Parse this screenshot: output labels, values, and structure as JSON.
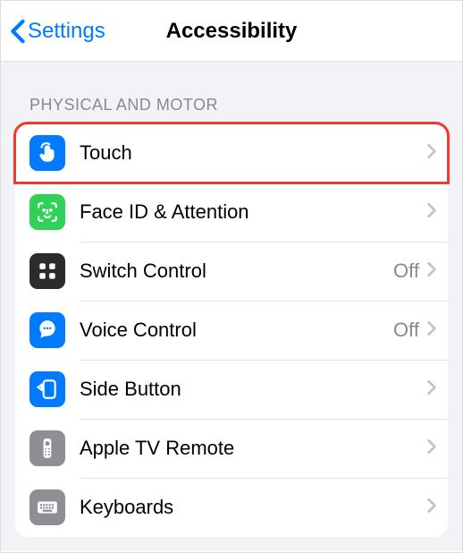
{
  "nav": {
    "back_label": "Settings",
    "title": "Accessibility"
  },
  "section": {
    "header": "PHYSICAL AND MOTOR"
  },
  "items": [
    {
      "label": "Touch",
      "status": "",
      "highlight": true
    },
    {
      "label": "Face ID & Attention",
      "status": "",
      "highlight": false
    },
    {
      "label": "Switch Control",
      "status": "Off",
      "highlight": false
    },
    {
      "label": "Voice Control",
      "status": "Off",
      "highlight": false
    },
    {
      "label": "Side Button",
      "status": "",
      "highlight": false
    },
    {
      "label": "Apple TV Remote",
      "status": "",
      "highlight": false
    },
    {
      "label": "Keyboards",
      "status": "",
      "highlight": false
    }
  ]
}
